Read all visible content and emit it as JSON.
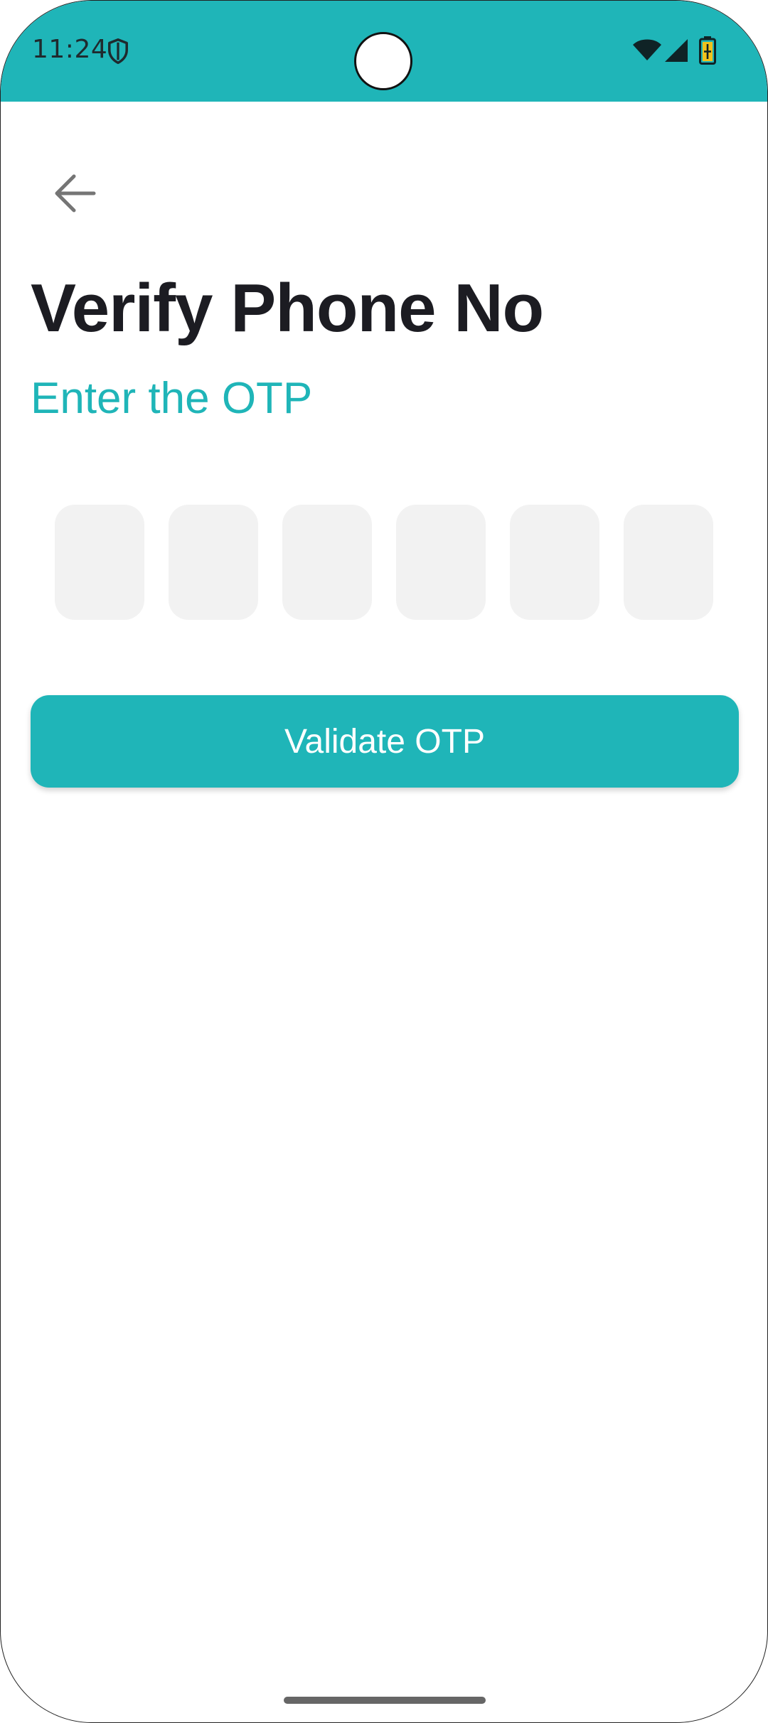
{
  "status_bar": {
    "time": "11:24",
    "background_color": "#1fb5b8",
    "icons": [
      "shield-icon",
      "wifi-icon",
      "signal-icon",
      "battery-icon"
    ]
  },
  "header": {
    "back_icon": "arrow-left-icon"
  },
  "main": {
    "title": "Verify Phone No",
    "subtitle": "Enter the OTP",
    "otp": {
      "digit_count": 6,
      "digits": [
        "",
        "",
        "",
        "",
        "",
        ""
      ]
    },
    "validate_button_label": "Validate OTP"
  },
  "colors": {
    "accent": "#1fb5b8",
    "title_text": "#1c1c22",
    "otp_box_fill": "#f2f2f2"
  }
}
